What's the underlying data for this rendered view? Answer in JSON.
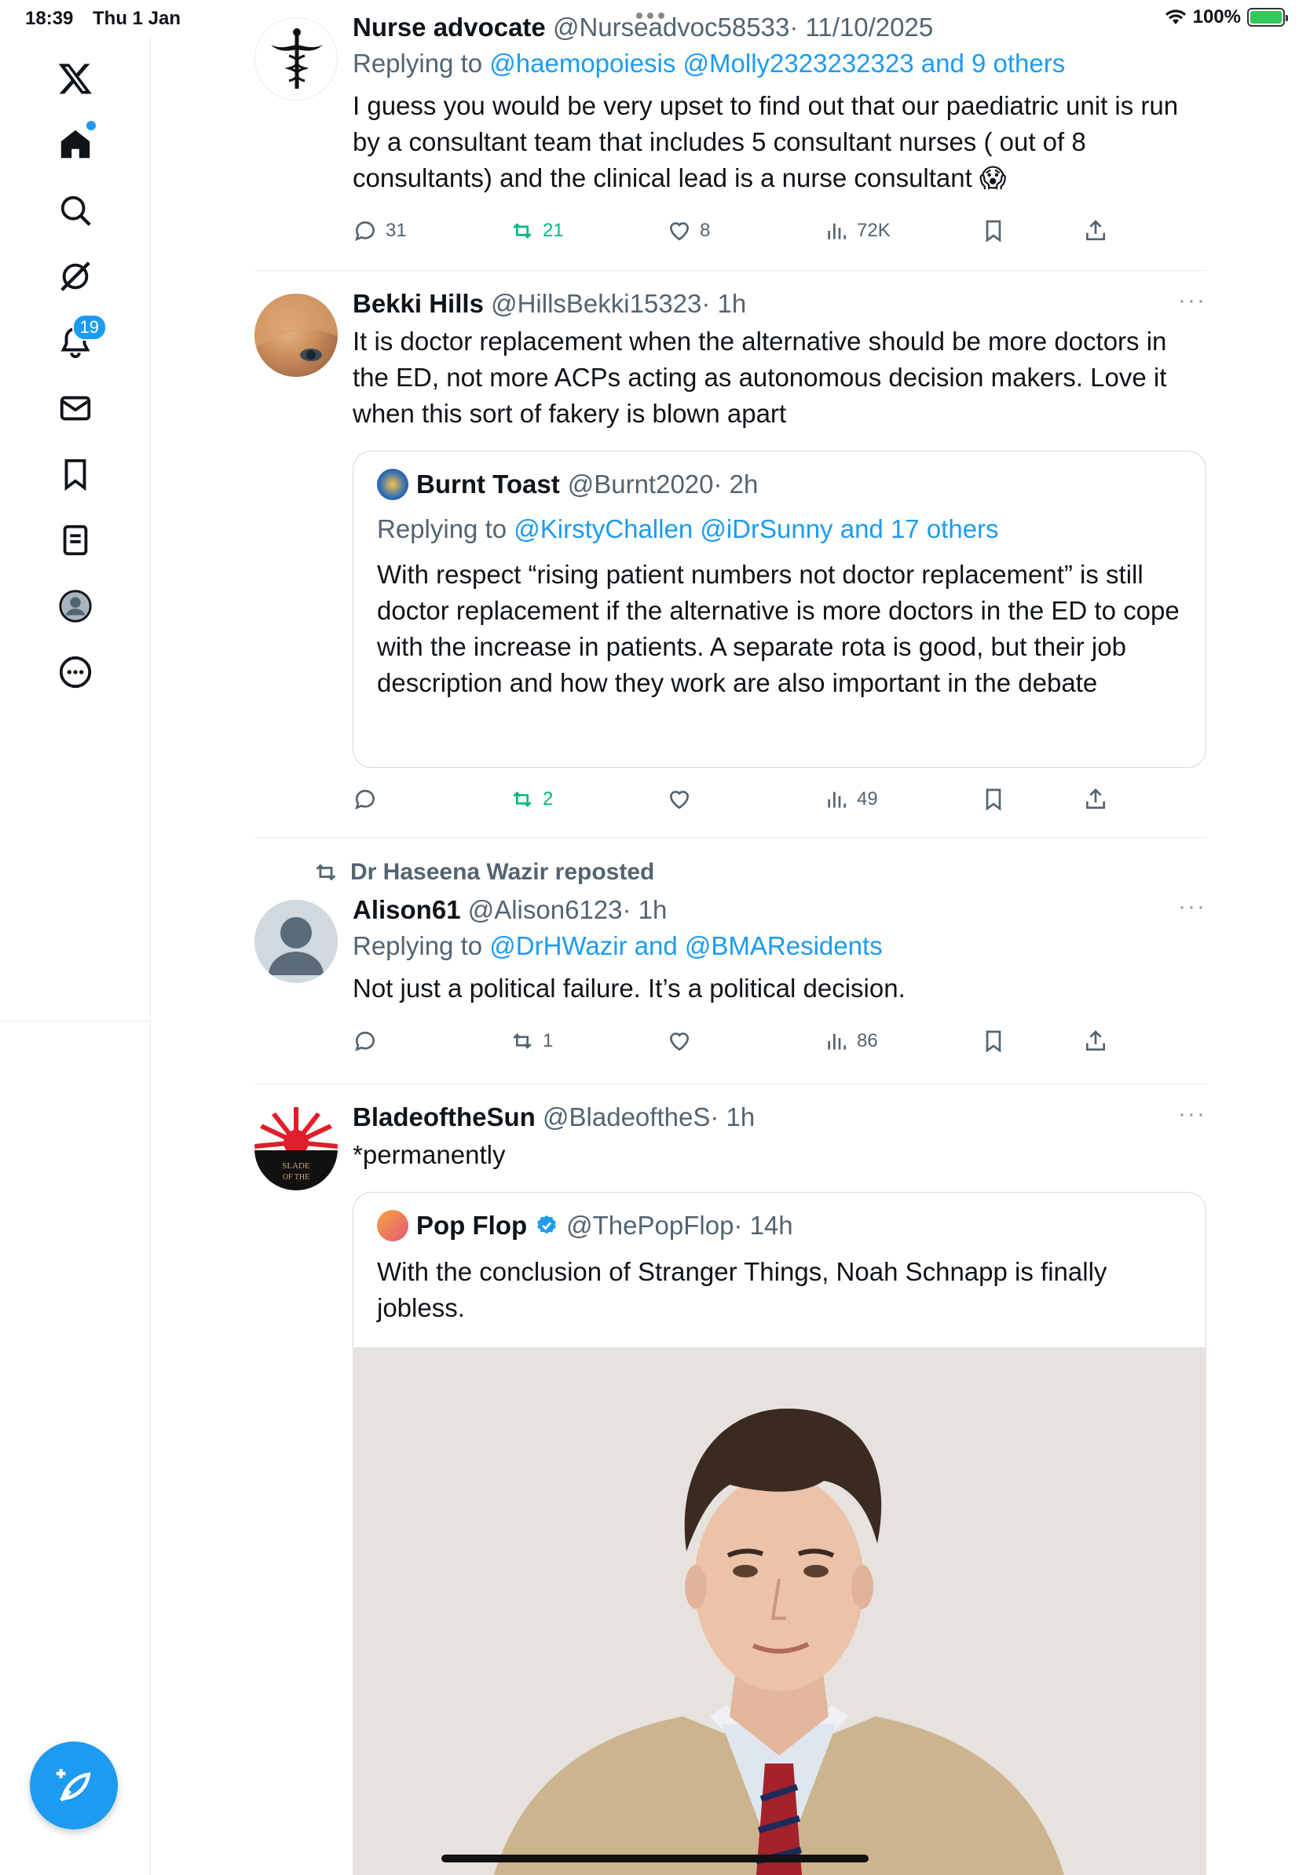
{
  "status_bar": {
    "time": "18:39",
    "date": "Thu 1 Jan",
    "battery": "100%"
  },
  "sidebar": {
    "notifications_badge": "19",
    "compose_label": "Post"
  },
  "tweets": [
    {
      "name": "Nurse advocate",
      "handle": "@Nurseadvoc58533",
      "time": "· 11/10/2025",
      "reply_prefix": "Replying to ",
      "reply_targets": "@haemopoiesis @Molly2323232323 and 9 others",
      "text": "I guess you would be very upset to find out that our paediatric unit is run by a consultant team that includes 5 consultant nurses ( out of 8 consultants) and the clinical lead is a nurse consultant 😱",
      "replies": "31",
      "reposts": "21",
      "likes": "8",
      "views": "72K"
    },
    {
      "name": "Bekki Hills",
      "handle": "@HillsBekki15323",
      "time": "· 1h",
      "text": "It is doctor replacement when the alternative should be more doctors in the ED, not more ACPs acting as autonomous decision makers. Love it when this sort of fakery is blown apart",
      "quote": {
        "name": "Burnt Toast",
        "handle": "@Burnt2020",
        "time": "· 2h",
        "reply_prefix": "Replying to ",
        "reply_targets": "@KirstyChallen @iDrSunny and 17 others",
        "text": "With respect “rising patient numbers not doctor replacement” is still doctor replacement if the alternative is more doctors in the ED to cope with the increase in patients. A separate rota is good, but their job description and how they work are also important in the debate"
      },
      "replies": "",
      "reposts": "2",
      "likes": "",
      "views": "49"
    },
    {
      "repost_by": "Dr Haseena Wazir reposted",
      "name": "Alison61",
      "handle": "@Alison6123",
      "time": "· 1h",
      "reply_prefix": "Replying to ",
      "reply_targets": "@DrHWazir and @BMAResidents",
      "text": "Not just a political failure. It’s a political decision.",
      "replies": "",
      "reposts": "1",
      "likes": "",
      "views": "86"
    },
    {
      "name": "BladeoftheSun",
      "handle": "@BladeoftheS",
      "time": "· 1h",
      "text": "*permanently",
      "quote": {
        "name": "Pop Flop",
        "handle": "@ThePopFlop",
        "time": "· 14h",
        "text": "With the conclusion of Stranger Things, Noah Schnapp is finally jobless."
      }
    }
  ],
  "colors": {
    "accent": "#1d9bf0",
    "repost_green": "#00ba7c",
    "muted": "#536471"
  }
}
